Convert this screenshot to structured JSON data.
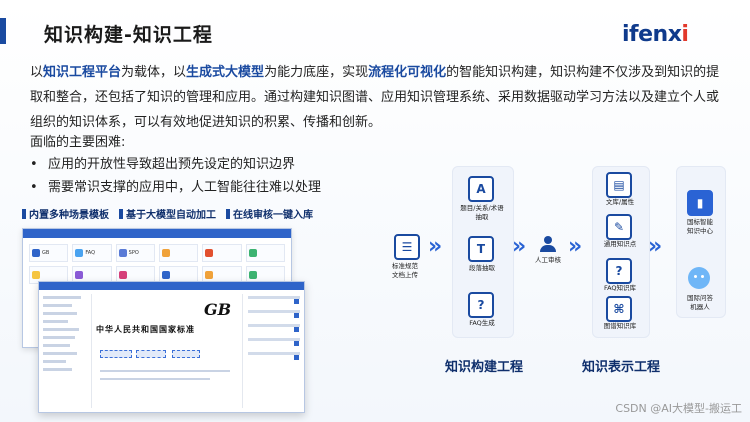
{
  "header": {
    "title": "知识构建-知识工程",
    "logo_main": "ifenx",
    "logo_dot": "i"
  },
  "intro": {
    "p1": "以",
    "h1": "知识工程平台",
    "p2": "为载体，以",
    "h2": "生成式大模型",
    "p3": "为能力底座，实现",
    "h3": "流程化可视化",
    "p4": "的智能知识构建，知识构建不仅涉及到知识的提取和整合，还包括了知识的管理和应用。通过构建知识图谱、应用知识管理系统、采用数据驱动学习方法以及建立个人或组织的知识体系，可以有效地促进知识的积累、传播和创新。"
  },
  "challenges": {
    "title": "面临的主要困难:",
    "items": [
      "应用的开放性导致超出预先设定的知识边界",
      "需要常识支撑的应用中，人工智能往往难以处理"
    ]
  },
  "tags": [
    "内置多种场景模板",
    "基于大模型自动加工",
    "在线审核一键入库"
  ],
  "screens": {
    "gb_logo": "GB",
    "standard_title": "中华人民共和国国家标准",
    "cells": [
      "GB",
      "FAQ",
      "SPO",
      "",
      "",
      "",
      "",
      "",
      "",
      "",
      "",
      ""
    ]
  },
  "flow": {
    "source": {
      "label": "标准规范\n文档上传",
      "icon": "document-icon"
    },
    "build_steps": [
      {
        "label": "题目/关系/术语\n抽取",
        "glyph": "A",
        "icon": "text-extract-icon"
      },
      {
        "label": "段落抽取",
        "glyph": "T",
        "icon": "paragraph-icon"
      },
      {
        "label": "FAQ生成",
        "glyph": "?",
        "icon": "faq-icon"
      }
    ],
    "review": {
      "label": "人工审核",
      "icon": "reviewer-icon"
    },
    "repr_steps": [
      {
        "label": "文库/属性",
        "icon": "book-icon"
      },
      {
        "label": "通用知识点",
        "icon": "edit-icon"
      },
      {
        "label": "FAQ知识库",
        "icon": "chat-icon"
      },
      {
        "label": "图谱知识库",
        "icon": "graph-icon"
      }
    ],
    "outputs": [
      {
        "label": "国标智能\n知识中心",
        "icon": "knowledge-center-icon"
      },
      {
        "label": "国际问答\n机器人",
        "icon": "robot-icon"
      }
    ],
    "build_title": "知识构建工程",
    "repr_title": "知识表示工程"
  },
  "footer": {
    "text": "CSDN @AI大模型-搬运工"
  },
  "colors": {
    "brand": "#1a4aa0",
    "accent": "#2a63d4",
    "logo_dot": "#e2382b"
  }
}
